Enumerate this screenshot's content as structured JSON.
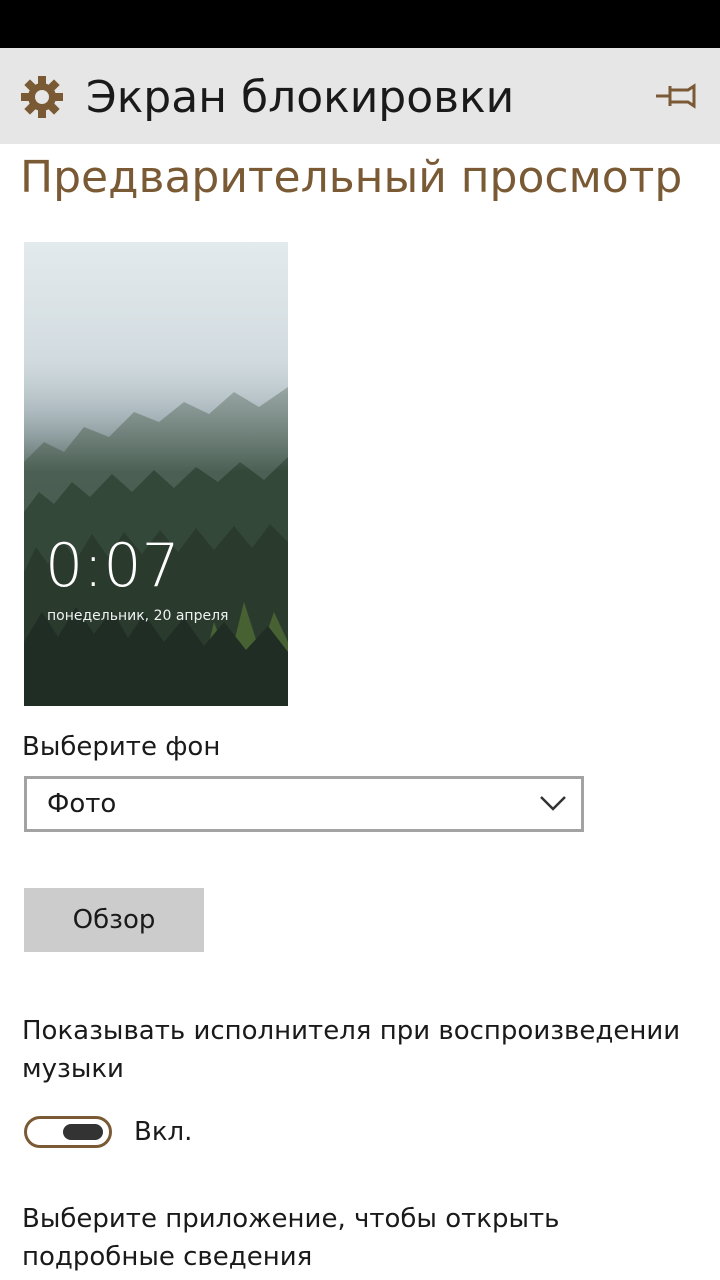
{
  "header": {
    "title": "Экран блокировки",
    "settings_icon": "gear-icon",
    "pin_icon": "pin-icon"
  },
  "preview_section": {
    "title": "Предварительный просмотр",
    "time": "0:07",
    "date": "понедельник, 20 апреля"
  },
  "background": {
    "label": "Выберите фон",
    "selected": "Фото",
    "browse_label": "Обзор"
  },
  "music": {
    "label": "Показывать исполнителя при воспроизведении музыки",
    "toggle_state": "Вкл."
  },
  "app_select": {
    "label": "Выберите приложение, чтобы открыть подробные сведения"
  },
  "colors": {
    "accent": "#7a5a34",
    "header_bg": "#e6e6e6",
    "button_bg": "#cccccc"
  }
}
